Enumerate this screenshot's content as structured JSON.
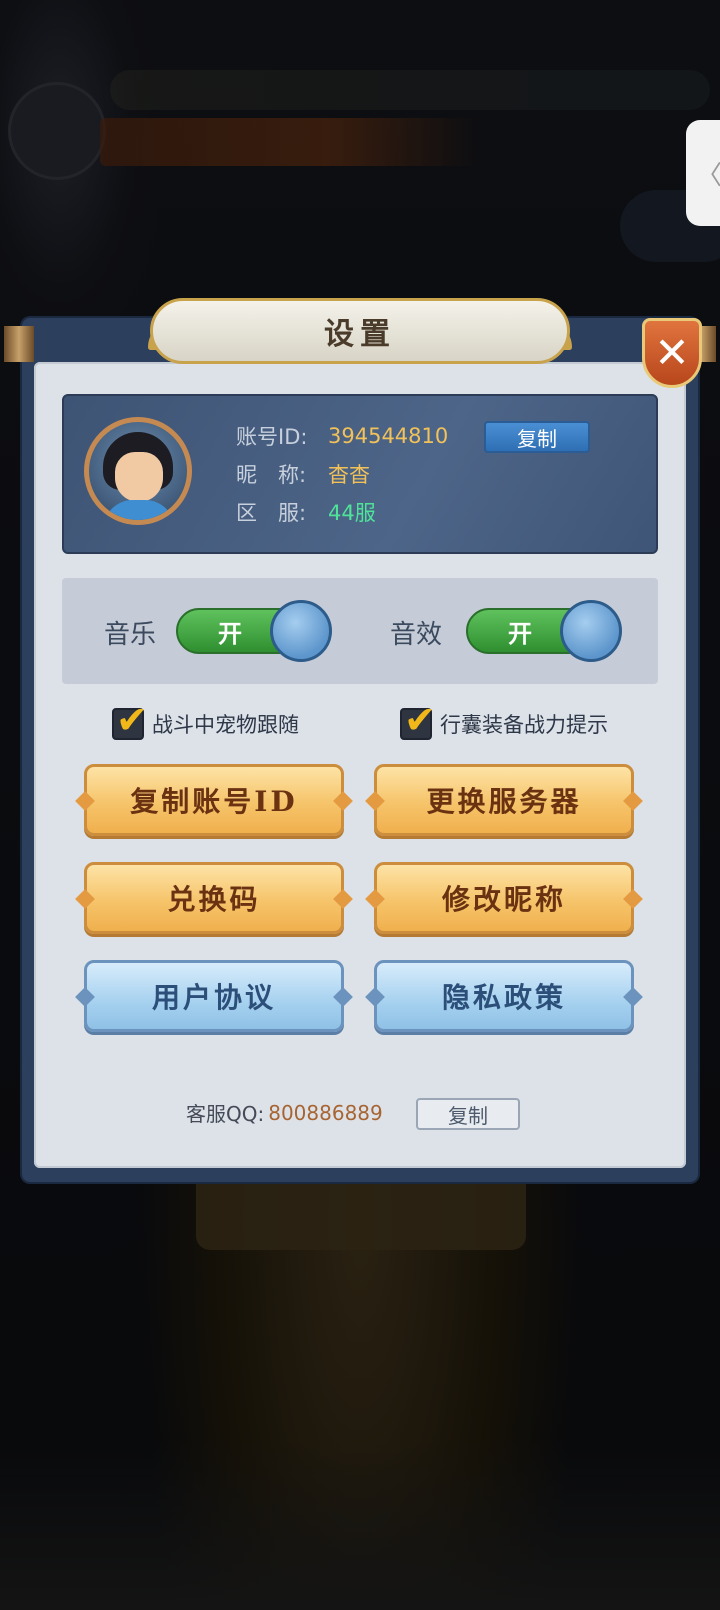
{
  "dialog": {
    "title": "设置",
    "close_icon": "close-icon"
  },
  "side_tab": {
    "glyph": "〈"
  },
  "account": {
    "id_label": "账号ID:",
    "id_value": "394544810",
    "copy_label": "复制",
    "nickname_label": "昵　称:",
    "nickname_value": "杳杳",
    "server_label": "区　服:",
    "server_value": "44服"
  },
  "toggles": {
    "music_label": "音乐",
    "music_state": "开",
    "sfx_label": "音效",
    "sfx_state": "开"
  },
  "checkboxes": {
    "pet_follow": "战斗中宠物跟随",
    "equip_power_hint": "行囊装备战力提示",
    "check_glyph": "✔"
  },
  "buttons": {
    "copy_account_id": "复制账号ID",
    "change_server": "更换服务器",
    "redeem_code": "兑换码",
    "change_nickname": "修改昵称",
    "user_agreement": "用户协议",
    "privacy_policy": "隐私政策"
  },
  "support": {
    "label": "客服QQ:",
    "number": "800886889",
    "copy_label": "复制"
  }
}
